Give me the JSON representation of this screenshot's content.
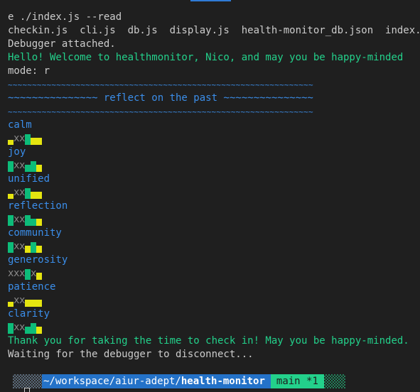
{
  "terminal": {
    "lines_top": [
      {
        "text": "e ./index.js --read",
        "color": "default"
      },
      {
        "text": "checkin.js  cli.js  db.js  display.js  health-monitor_db.json  index.js",
        "color": "default"
      },
      {
        "text": "Debugger attached.",
        "color": "default"
      },
      {
        "text": "Hello! Welcome to healthmonitor, Nico, and may you be happy-minded",
        "color": "green"
      },
      {
        "text": "mode: r",
        "color": "default"
      }
    ],
    "separator": "~~~~~~~~~~~~~~~~~~~~~~~~~~~~~~~~~~~~~~~~~~~~~~~~~~~~~~~~~~~~~~~",
    "reflect_heading": "~~~~~~~~~~~~~~~ reflect on the past ~~~~~~~~~~~~~~~",
    "categories": [
      {
        "label": "calm",
        "cells": [
          "y-low",
          "x",
          "x",
          "g-full",
          "y-mid",
          "y-mid"
        ]
      },
      {
        "label": "joy",
        "cells": [
          "g-full",
          "x",
          "x",
          "g-mid",
          "g-full",
          "y-mid"
        ]
      },
      {
        "label": "unified",
        "cells": [
          "y-low",
          "x",
          "x",
          "g-full",
          "y-mid",
          "y-mid"
        ]
      },
      {
        "label": "reflection",
        "cells": [
          "g-full",
          "x",
          "x",
          "g-full",
          "g-mid",
          "y-mid"
        ]
      },
      {
        "label": "community",
        "cells": [
          "g-full",
          "x",
          "x",
          "y-mid",
          "g-full",
          "y-mid"
        ]
      },
      {
        "label": "generosity",
        "cells": [
          "x",
          "x",
          "x",
          "g-full",
          "x",
          "y-mid"
        ]
      },
      {
        "label": "patience",
        "cells": [
          "y-low",
          "x",
          "x",
          "y-mid",
          "y-mid",
          "y-mid"
        ]
      },
      {
        "label": "clarity",
        "cells": [
          "g-full",
          "x",
          "x",
          "g-mid",
          "g-full",
          "y-mid"
        ]
      }
    ],
    "cell_symbol": "x",
    "lines_bottom": [
      {
        "text": "Thank you for taking the time to check in! May you be happy-minded.",
        "color": "green"
      },
      {
        "text": "Waiting for the debugger to disconnect...",
        "color": "default"
      }
    ]
  },
  "prompt": {
    "path_prefix": "~/workspace/aiur-adept/",
    "path_current": "health-monitor",
    "git_branch": "main *1"
  },
  "colors": {
    "background": "#1f1f1f",
    "text": "#cccccc",
    "green": "#23d18b",
    "blue": "#3b8eea",
    "bar_yellow": "#e5e510",
    "bar_green": "#0dbc79",
    "prompt_path_bg": "#2472c8",
    "prompt_git_bg": "#23d18b"
  }
}
